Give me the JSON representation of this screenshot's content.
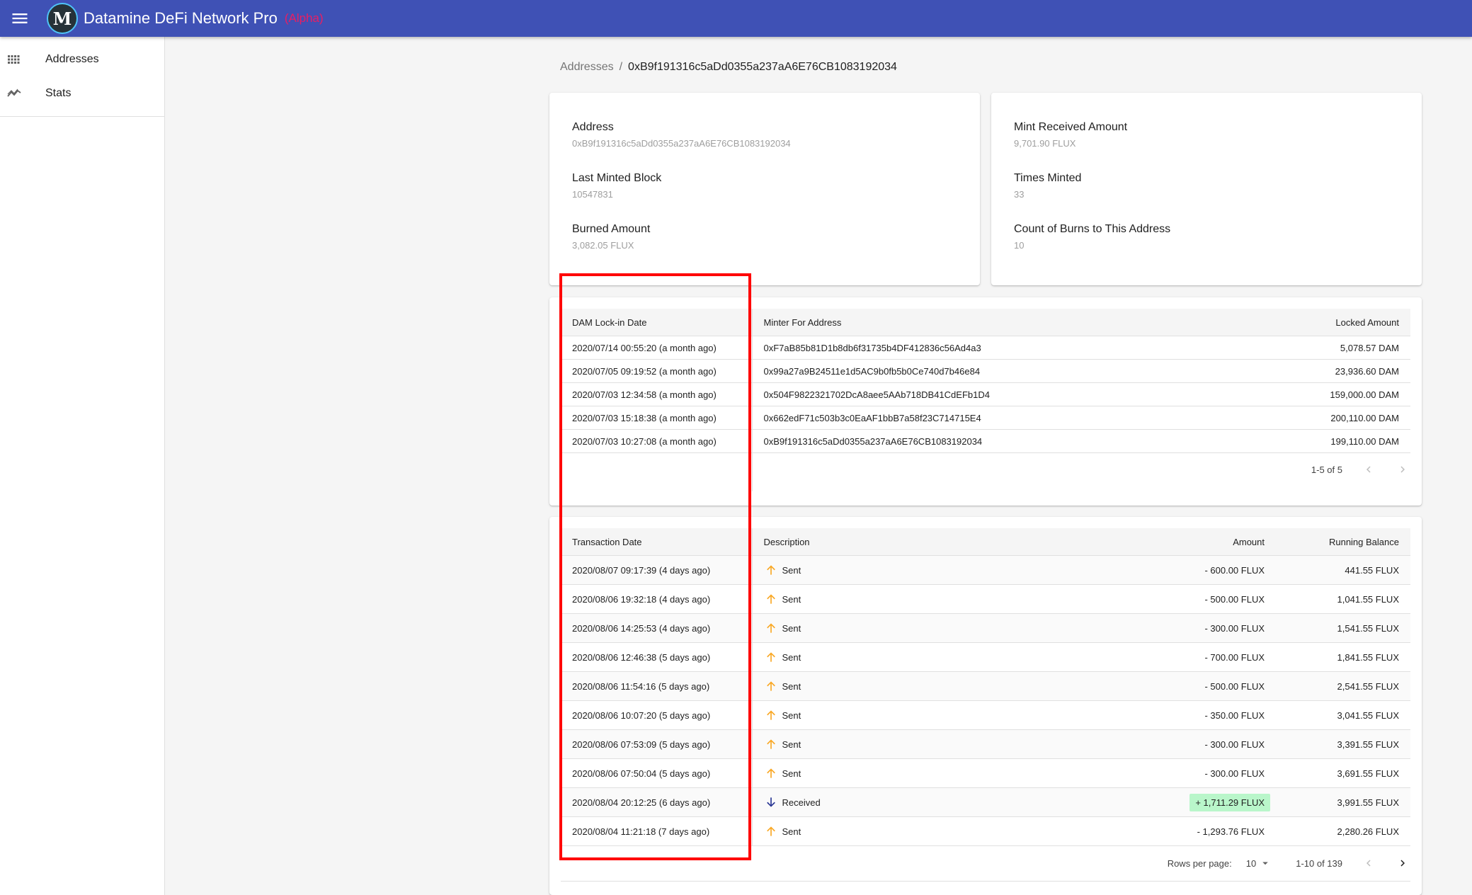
{
  "appbar": {
    "menu_icon": "menu-icon",
    "logo_text": "M",
    "title": "Datamine DeFi Network Pro",
    "badge": "(Alpha)",
    "color": "#3f51b5",
    "badge_color": "#e91e63"
  },
  "sidebar": {
    "items": [
      {
        "label": "Addresses",
        "icon": "grid-icon"
      },
      {
        "label": "Stats",
        "icon": "trending-icon"
      }
    ]
  },
  "breadcrumb": {
    "parent": "Addresses",
    "separator": "/",
    "current": "0xB9f191316c5aDd0355a237aA6E76CB1083192034"
  },
  "summary_left": {
    "address_label": "Address",
    "address_value": "0xB9f191316c5aDd0355a237aA6E76CB1083192034",
    "last_minted_label": "Last Minted Block",
    "last_minted_value": "10547831",
    "burned_label": "Burned Amount",
    "burned_value": "3,082.05 FLUX"
  },
  "summary_right": {
    "mint_received_label": "Mint Received Amount",
    "mint_received_value": "9,701.90 FLUX",
    "times_minted_label": "Times Minted",
    "times_minted_value": "33",
    "burn_count_label": "Count of Burns to This Address",
    "burn_count_value": "10"
  },
  "locks": {
    "headers": {
      "date": "DAM Lock-in Date",
      "minter": "Minter For Address",
      "amount": "Locked Amount"
    },
    "rows": [
      {
        "date": "2020/07/14 00:55:20 (a month ago)",
        "minter": "0xF7aB85b81D1b8db6f31735b4DF412836c56Ad4a3",
        "amount": "5,078.57 DAM"
      },
      {
        "date": "2020/07/05 09:19:52 (a month ago)",
        "minter": "0x99a27a9B24511e1d5AC9b0fb5b0Ce740d7b46e84",
        "amount": "23,936.60 DAM"
      },
      {
        "date": "2020/07/03 12:34:58 (a month ago)",
        "minter": "0x504F9822321702DcA8aee5AAb718DB41CdEFb1D4",
        "amount": "159,000.00 DAM"
      },
      {
        "date": "2020/07/03 15:18:38 (a month ago)",
        "minter": "0x662edF71c503b3c0EaAF1bbB7a58f23C714715E4",
        "amount": "200,110.00 DAM"
      },
      {
        "date": "2020/07/03 10:27:08 (a month ago)",
        "minter": "0xB9f191316c5aDd0355a237aA6E76CB1083192034",
        "amount": "199,110.00 DAM"
      }
    ],
    "pagination": "1-5 of 5"
  },
  "transactions": {
    "headers": {
      "date": "Transaction Date",
      "description": "Description",
      "amount": "Amount",
      "balance": "Running Balance"
    },
    "rows": [
      {
        "date": "2020/08/07 09:17:39 (4 days ago)",
        "type": "sent",
        "description": "Sent",
        "amount": "- 600.00 FLUX",
        "balance": "441.55 FLUX"
      },
      {
        "date": "2020/08/06 19:32:18 (4 days ago)",
        "type": "sent",
        "description": "Sent",
        "amount": "- 500.00 FLUX",
        "balance": "1,041.55 FLUX"
      },
      {
        "date": "2020/08/06 14:25:53 (4 days ago)",
        "type": "sent",
        "description": "Sent",
        "amount": "- 300.00 FLUX",
        "balance": "1,541.55 FLUX"
      },
      {
        "date": "2020/08/06 12:46:38 (5 days ago)",
        "type": "sent",
        "description": "Sent",
        "amount": "- 700.00 FLUX",
        "balance": "1,841.55 FLUX"
      },
      {
        "date": "2020/08/06 11:54:16 (5 days ago)",
        "type": "sent",
        "description": "Sent",
        "amount": "- 500.00 FLUX",
        "balance": "2,541.55 FLUX"
      },
      {
        "date": "2020/08/06 10:07:20 (5 days ago)",
        "type": "sent",
        "description": "Sent",
        "amount": "- 350.00 FLUX",
        "balance": "3,041.55 FLUX"
      },
      {
        "date": "2020/08/06 07:53:09 (5 days ago)",
        "type": "sent",
        "description": "Sent",
        "amount": "- 300.00 FLUX",
        "balance": "3,391.55 FLUX"
      },
      {
        "date": "2020/08/06 07:50:04 (5 days ago)",
        "type": "sent",
        "description": "Sent",
        "amount": "- 300.00 FLUX",
        "balance": "3,691.55 FLUX"
      },
      {
        "date": "2020/08/04 20:12:25 (6 days ago)",
        "type": "received",
        "description": "Received",
        "amount": "+ 1,711.29 FLUX",
        "balance": "3,991.55 FLUX"
      },
      {
        "date": "2020/08/04 11:21:18 (7 days ago)",
        "type": "sent",
        "description": "Sent",
        "amount": "- 1,293.76 FLUX",
        "balance": "2,280.26 FLUX"
      }
    ],
    "rows_per_page_label": "Rows per page:",
    "rows_per_page_value": "10",
    "pagination": "1-10 of 139"
  },
  "colors": {
    "sent_arrow": "#f9a825",
    "received_arrow": "#283593",
    "received_chip": "#b9f6ca",
    "highlight_box": "#ff0000"
  }
}
